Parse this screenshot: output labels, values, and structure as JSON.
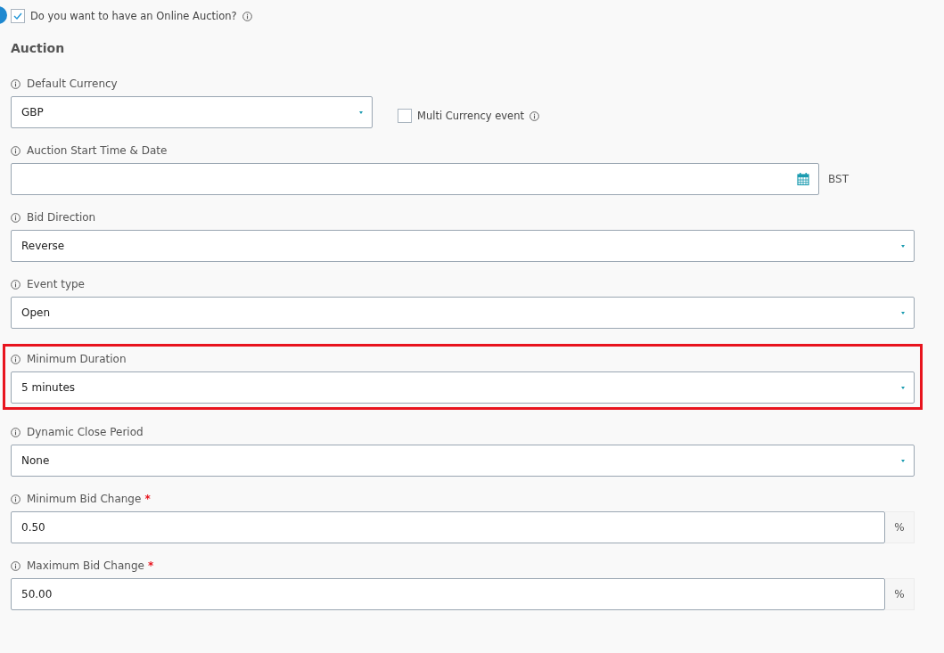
{
  "online_auction": {
    "label": "Do you want to have an Online Auction?",
    "checked": true
  },
  "section_title": "Auction",
  "fields": [
    {
      "kind": "select",
      "label": "Default Currency",
      "value": "GBP",
      "highlighted": false,
      "side_checkbox": {
        "label": "Multi Currency event",
        "checked": false
      }
    },
    {
      "kind": "date",
      "label": "Auction Start Time & Date",
      "suffix": "BST",
      "highlighted": false
    },
    {
      "kind": "select",
      "label": "Bid Direction",
      "value": "Reverse",
      "highlighted": false
    },
    {
      "kind": "select",
      "label": "Event type",
      "value": "Open",
      "highlighted": false
    },
    {
      "kind": "select",
      "label": "Minimum Duration",
      "value": "5 minutes",
      "highlighted": true
    },
    {
      "kind": "select",
      "label": "Dynamic Close Period",
      "value": "None",
      "highlighted": false
    },
    {
      "kind": "percent",
      "label": "Minimum Bid Change",
      "value": "0.50",
      "addon": "%",
      "required_mark": "*",
      "highlighted": false
    },
    {
      "kind": "percent",
      "label": "Maximum Bid Change",
      "value": "50.00",
      "addon": "%",
      "required_mark": "*",
      "highlighted": false
    }
  ]
}
